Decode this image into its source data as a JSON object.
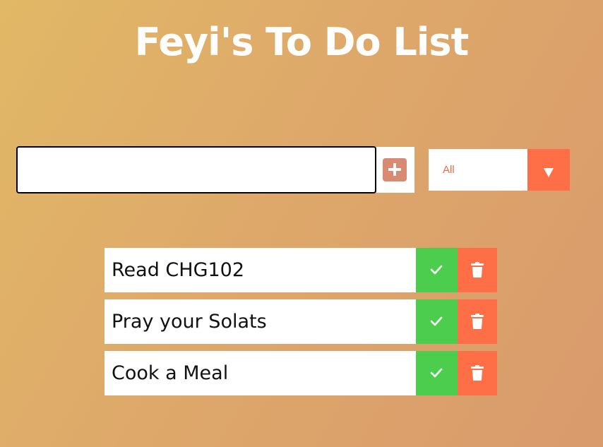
{
  "header": {
    "title": "Feyi's To Do List"
  },
  "form": {
    "input_value": "",
    "add_icon": "plus-icon",
    "filter": {
      "selected": "All",
      "arrow_icon": "caret-down-icon"
    }
  },
  "todos": [
    {
      "text": "Read CHG102",
      "complete_icon": "check-icon",
      "delete_icon": "trash-icon"
    },
    {
      "text": "Pray your Solats",
      "complete_icon": "check-icon",
      "delete_icon": "trash-icon"
    },
    {
      "text": "Cook a Meal",
      "complete_icon": "check-icon",
      "delete_icon": "trash-icon"
    }
  ],
  "colors": {
    "accent": "#ff6f47",
    "complete": "#4dcd4d",
    "add_button": "#d98a72",
    "title": "#ffffff"
  }
}
